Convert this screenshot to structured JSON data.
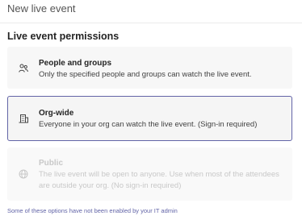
{
  "header": {
    "title": "New live event"
  },
  "section": {
    "title": "Live event permissions"
  },
  "options": [
    {
      "title": "People and groups",
      "description": "Only the specified people and groups can watch the live event.",
      "icon": "people-icon",
      "state": "enabled"
    },
    {
      "title": "Org-wide",
      "description": "Everyone in your org can watch the live event. (Sign-in required)",
      "icon": "building-icon",
      "state": "selected"
    },
    {
      "title": "Public",
      "description": "The live event will be open to anyone. Use when most of the attendees are outside your org. (No sign-in required)",
      "icon": "globe-icon",
      "state": "disabled"
    }
  ],
  "footnote": "Some of these options have not been enabled by your IT admin",
  "colors": {
    "accent": "#6264a7",
    "disabled_text": "#c8c8c8",
    "card_background": "#f7f7f7"
  }
}
